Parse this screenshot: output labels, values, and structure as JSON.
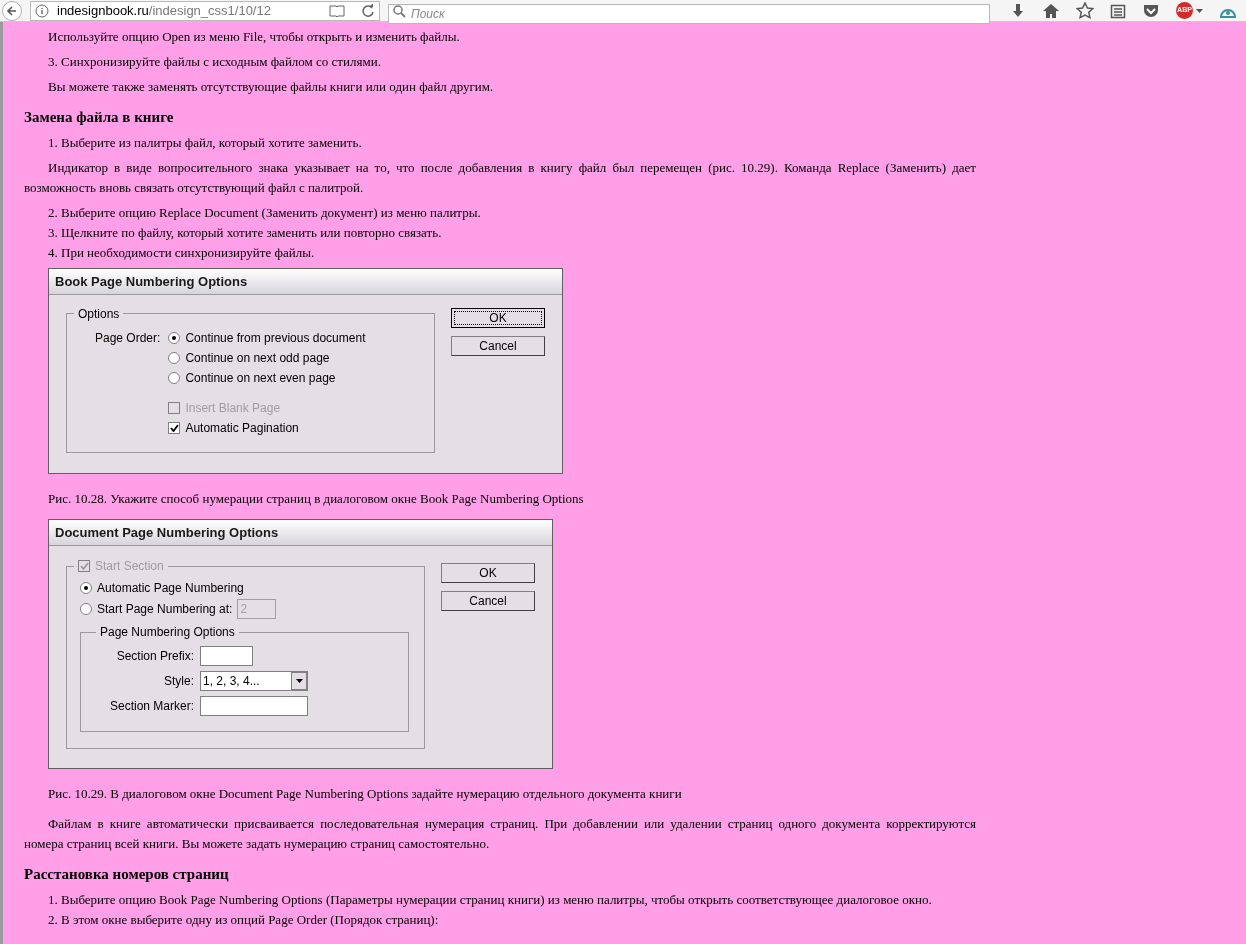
{
  "browser": {
    "url_host": "indesignbook.ru",
    "url_path": "/indesign_css1/10/12",
    "search_placeholder": "Поиск",
    "adblock_badge": "ABP"
  },
  "blocks": [
    {
      "kind": "para",
      "text": "Используйте опцию Open из меню File, чтобы открыть и изменить файлы."
    },
    {
      "kind": "item",
      "text": "3. Синхронизируйте файлы с исходным файлом со стилями."
    },
    {
      "kind": "para",
      "text": "Вы можете также заменять отсутствующие файлы книги или один файл другим."
    },
    {
      "kind": "heading",
      "text": "Замена файла в книге"
    },
    {
      "kind": "item",
      "text": "1. Выберите из палитры файл, который хотите заменить."
    },
    {
      "kind": "para",
      "text": "Индикатор в виде вопросительного знака указывает на то, что после добавления в книгу файл был перемещен (рис. 10.29). Команда Replace (Заменить) дает возможность вновь связать отсутствующий файл с палитрой."
    },
    {
      "kind": "item",
      "text": "2. Выберите опцию Replace Document (Заменить документ) из меню палитры."
    },
    {
      "kind": "item",
      "text": "3. Щелкните по файлу, который хотите заменить или повторно связать."
    },
    {
      "kind": "item",
      "text": "4. При необходимости синхронизируйте файлы."
    },
    {
      "kind": "book_dialog",
      "title": "Book Page Numbering Options",
      "legend": "Options",
      "order_label": "Page Order:",
      "radios": [
        {
          "label": "Continue from previous document",
          "selected": true
        },
        {
          "label": "Continue on next odd page",
          "selected": false
        },
        {
          "label": "Continue on next even page",
          "selected": false
        }
      ],
      "checkboxes": [
        {
          "label": "Insert Blank Page",
          "checked": false,
          "disabled": true
        },
        {
          "label": "Automatic Pagination",
          "checked": true,
          "disabled": false
        }
      ],
      "buttons": [
        {
          "label": "OK",
          "focused": true
        },
        {
          "label": "Cancel",
          "focused": false
        }
      ]
    },
    {
      "kind": "caption",
      "text": "Рис. 10.28. Укажите способ нумерации страниц в диалоговом окне Book Page Numbering Options"
    },
    {
      "kind": "doc_dialog",
      "title": "Document Page Numbering Options",
      "start_section": {
        "label": "Start Section",
        "checked": true,
        "disabled": true
      },
      "radios": [
        {
          "label": "Automatic Page Numbering",
          "selected": true
        },
        {
          "label": "Start Page Numbering at:",
          "selected": false
        }
      ],
      "start_at": {
        "value": "2",
        "disabled": true
      },
      "sub_legend": "Page Numbering Options",
      "prefix_label": "Section Prefix:",
      "style_label": "Style:",
      "style_value": "1, 2, 3, 4...",
      "marker_label": "Section Marker:",
      "buttons": [
        {
          "label": "OK",
          "focused": false
        },
        {
          "label": "Cancel",
          "focused": false
        }
      ]
    },
    {
      "kind": "caption",
      "text": "Рис. 10.29. В диалоговом окне Document Page Numbering Options задайте нумерацию отдельного документа книги"
    },
    {
      "kind": "para",
      "text": "Файлам в книге автоматически присваивается последовательная нумерация страниц. При добавлении или удалении страниц одного документа корректируются номера страниц всей книги. Вы можете задать нумерацию страниц самостоятельно."
    },
    {
      "kind": "heading",
      "text": "Расстановка номеров страниц"
    },
    {
      "kind": "item",
      "text": "1. Выберите опцию Book Page Numbering Options (Параметры нумерации страниц книги) из меню палитры, чтобы открыть соответствующее диалоговое окно."
    },
    {
      "kind": "item",
      "text": "2. В этом окне выберите одну из опций Page Order (Порядок страниц):"
    }
  ]
}
